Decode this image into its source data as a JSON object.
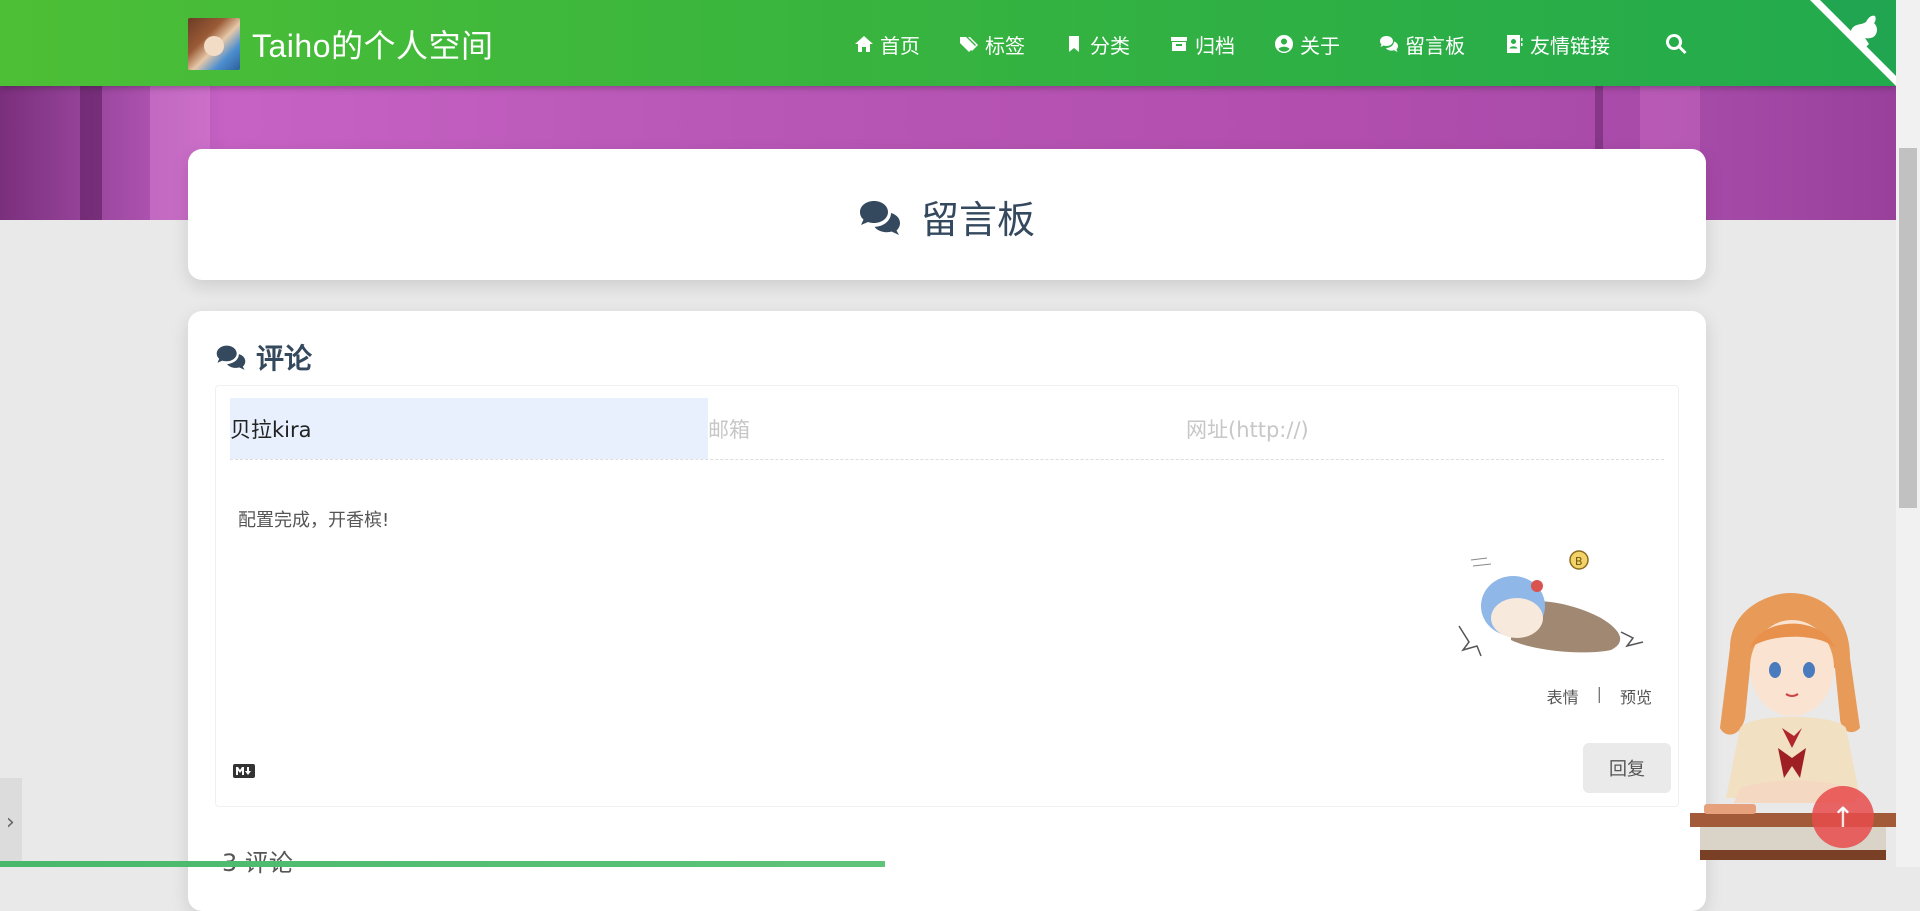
{
  "navbar": {
    "site_title": "Taiho的个人空间",
    "items": [
      {
        "label": "首页",
        "icon": "home-icon"
      },
      {
        "label": "标签",
        "icon": "tags-icon"
      },
      {
        "label": "分类",
        "icon": "bookmark-icon"
      },
      {
        "label": "归档",
        "icon": "archive-icon"
      },
      {
        "label": "关于",
        "icon": "user-circle-icon"
      },
      {
        "label": "留言板",
        "icon": "comments-icon"
      },
      {
        "label": "友情链接",
        "icon": "address-book-icon"
      }
    ],
    "search_icon": "search-icon",
    "accent_color": "#3ab53d"
  },
  "page": {
    "title": "留言板"
  },
  "comments": {
    "heading": "评论",
    "name_value": "贝拉kira",
    "email_placeholder": "邮箱",
    "url_placeholder": "网址(http://)",
    "content_text": "配置完成，开香槟!",
    "emoji_label": "表情",
    "separator": "|",
    "preview_label": "预览",
    "reply_label": "回复",
    "count_text": "3 评论"
  },
  "progress": {
    "read_fraction": 0.467
  }
}
